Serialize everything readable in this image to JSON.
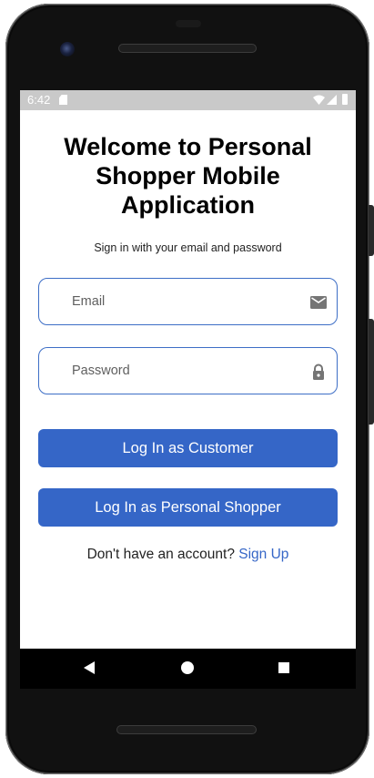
{
  "status_bar": {
    "time": "6:42",
    "icons": [
      "sd-card-icon",
      "wifi-icon",
      "signal-icon",
      "battery-icon"
    ]
  },
  "login": {
    "title": "Welcome to Personal Shopper Mobile Application",
    "subtitle": "Sign in with your email and password",
    "email": {
      "placeholder": "Email",
      "value": "",
      "icon": "mail-icon"
    },
    "password": {
      "placeholder": "Password",
      "value": "",
      "icon": "lock-icon"
    },
    "customer_button_label": "Log In as Customer",
    "shopper_button_label": "Log In as Personal Shopper",
    "signup_prompt": "Don't have an account?",
    "signup_link": "Sign Up"
  },
  "nav_bar": {
    "icons": [
      "back-icon",
      "home-icon",
      "recents-icon"
    ]
  },
  "colors": {
    "primary": "#3566c7",
    "field_border": "#3d6ec6",
    "status_bar": "#c9c9c9",
    "nav_bar": "#000000"
  }
}
